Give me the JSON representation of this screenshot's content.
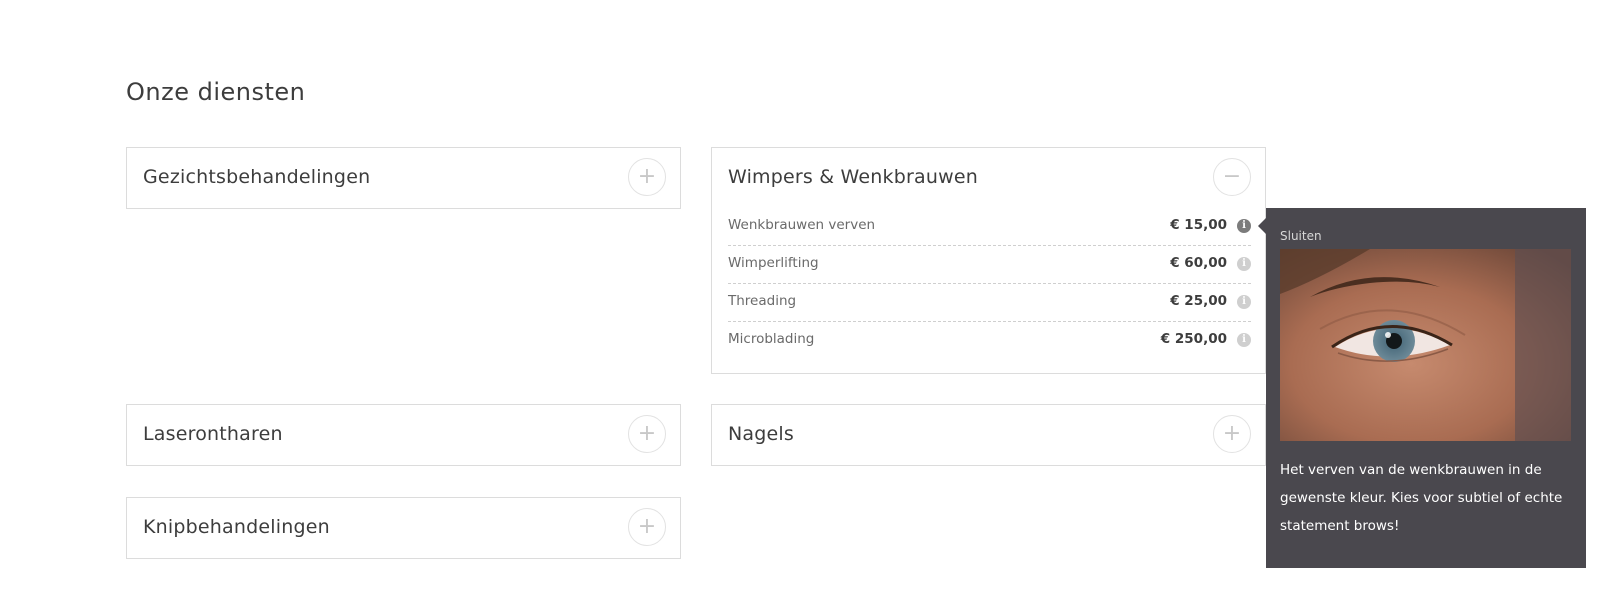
{
  "page": {
    "title": "Onze diensten"
  },
  "panels": [
    {
      "title": "Gezichtsbehandelingen",
      "toggle": "+",
      "expanded": false
    },
    {
      "title": "Wimpers & Wenkbrauwen",
      "toggle": "−",
      "expanded": true,
      "services": [
        {
          "name": "Wenkbrauwen verven",
          "price": "€ 15,00",
          "info_icon": "i"
        },
        {
          "name": "Wimperlifting",
          "price": "€ 60,00",
          "info_icon": "i"
        },
        {
          "name": "Threading",
          "price": "€ 25,00",
          "info_icon": "i"
        },
        {
          "name": "Microblading",
          "price": "€ 250,00",
          "info_icon": "i"
        }
      ]
    },
    {
      "title": "Laserontharen",
      "toggle": "+",
      "expanded": false
    },
    {
      "title": "Nagels",
      "toggle": "+",
      "expanded": false
    },
    {
      "title": "Knipbehandelingen",
      "toggle": "+",
      "expanded": false
    }
  ],
  "tooltip": {
    "close_label": "Sluiten",
    "image": "eye-closeup-photo",
    "description": "Het verven van de wenkbrauwen in de gewenste kleur. Kies voor subtiel of echte statement brows!"
  },
  "colors": {
    "tooltip_background": "#4a484e",
    "border": "#dcdcdc",
    "text": "#3d3d3d"
  }
}
